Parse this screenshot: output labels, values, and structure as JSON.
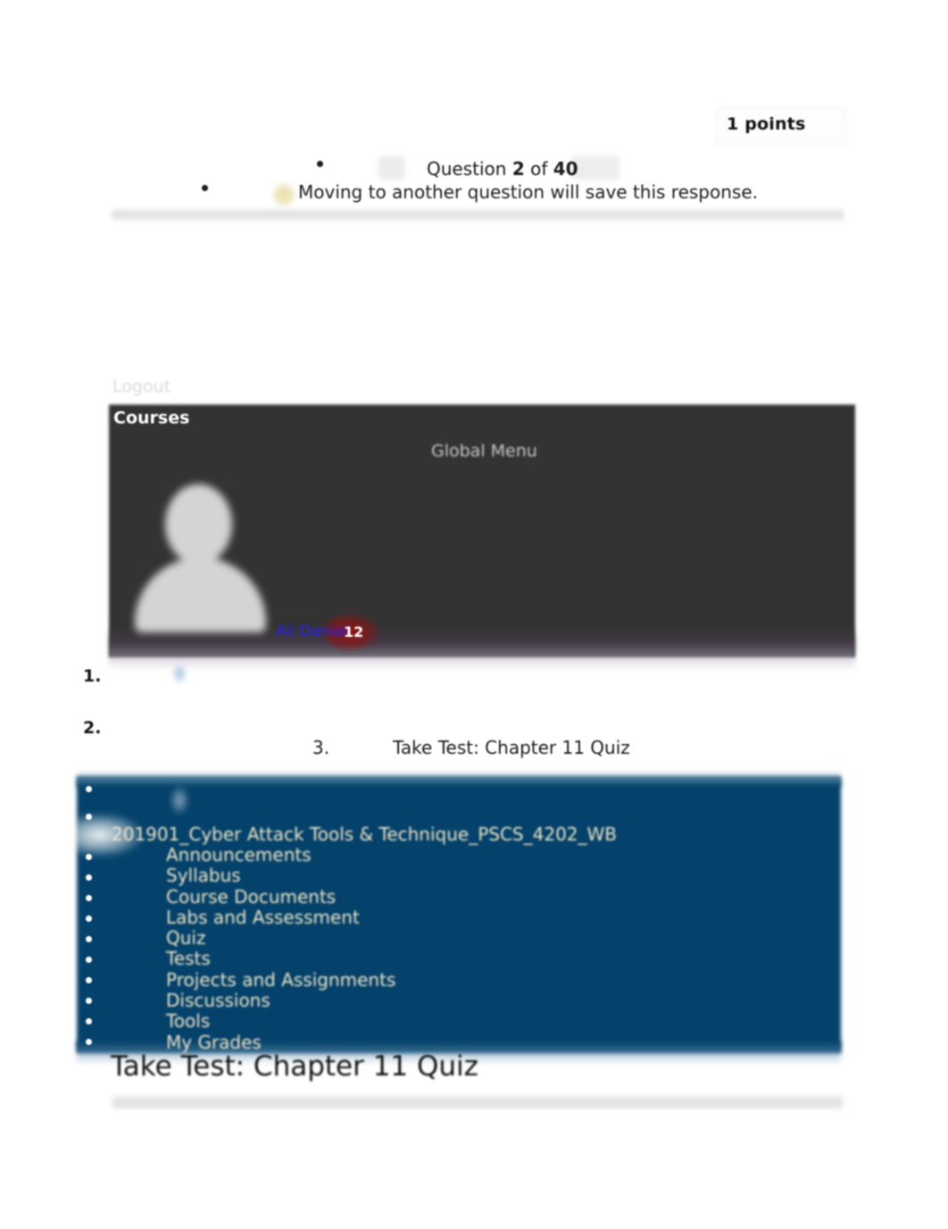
{
  "assessment": {
    "points_label": "1 points",
    "question_counter_prefix": "Question",
    "question_number": "2",
    "question_counter_mid": "of",
    "question_total": "40",
    "save_note": "Moving to another question will save this response.",
    "page_heading": "Take Test: Chapter 11 Quiz",
    "breadcrumb_marker": "3.",
    "breadcrumb_title": "Take Test: Chapter 11 Quiz"
  },
  "global_nav": {
    "logout_label": "Logout",
    "courses_label": "Courses",
    "global_menu_label": "Global Menu",
    "user_name": "Ali Danial",
    "notification_count": "12",
    "avatar_icon": "user-avatar-icon"
  },
  "list_markers": {
    "item_1": "1.",
    "item_2": "2."
  },
  "course_menu": {
    "course_title": "201901_Cyber Attack Tools & Technique_PSCS_4202_WB",
    "items": [
      {
        "label": "Announcements"
      },
      {
        "label": "Syllabus"
      },
      {
        "label": "Course Documents"
      },
      {
        "label": "Labs and Assessment"
      },
      {
        "label": "Quiz"
      },
      {
        "label": "Tests"
      },
      {
        "label": "Projects and Assignments"
      },
      {
        "label": "Discussions"
      },
      {
        "label": "Tools"
      },
      {
        "label": "My Grades"
      }
    ]
  },
  "colors": {
    "course_menu_bg": "#04426b",
    "course_menu_text": "#f0e5c4",
    "global_menu_bg": "#333333",
    "user_name_color": "#2222f5",
    "notification_badge": "#96100e",
    "divider_bar": "#e2e2e2"
  }
}
